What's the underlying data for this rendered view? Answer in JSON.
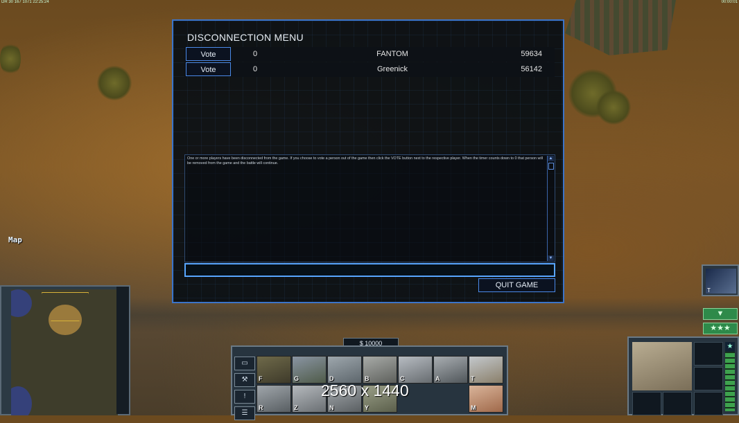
{
  "topbar": {
    "left_text": "DR 30 167 1071 22:25:24",
    "right_text": "00:00:01"
  },
  "map_label": "Map",
  "dialog": {
    "title": "DISCONNECTION MENU",
    "players": [
      {
        "vote_label": "Vote",
        "votes": "0",
        "name": "FANTOM",
        "ping": "59634"
      },
      {
        "vote_label": "Vote",
        "votes": "0",
        "name": "Greenick",
        "ping": "56142"
      }
    ],
    "message": "One or more players have been disconnected from the game. If you choose to vote a person out of the game then click the VOTE button next to the respective player. When the timer counts down to 0 that person will be removed from the game and the battle will continue.",
    "chat_value": "",
    "quit_label": "QUIT GAME"
  },
  "command_bar": {
    "money": "$ 10000",
    "side_icons": [
      "options-icon",
      "repair-icon",
      "alert-icon",
      "planning-icon"
    ],
    "buttons_row1": [
      {
        "hotkey": "F",
        "icon": "dozer-icon"
      },
      {
        "hotkey": "G",
        "icon": "infantry-icon"
      },
      {
        "hotkey": "D",
        "icon": "airfield-icon"
      },
      {
        "hotkey": "B",
        "icon": "artillery-icon"
      },
      {
        "hotkey": "C",
        "icon": "missile-icon"
      },
      {
        "hotkey": "A",
        "icon": "factory-icon"
      },
      {
        "hotkey": "T",
        "icon": "tower-icon"
      }
    ],
    "buttons_row2": [
      {
        "hotkey": "R",
        "icon": "reactor-icon"
      },
      {
        "hotkey": "Z",
        "icon": "aircraft-icon"
      },
      {
        "hotkey": "N",
        "icon": "barracks-icon"
      },
      {
        "hotkey": "Y",
        "icon": "supply-icon"
      },
      {
        "hotkey": "M",
        "icon": "ammo-icon"
      }
    ],
    "overlay_text": "2560 x 1440"
  },
  "right_panel": {
    "generals_hotkey": "T",
    "green_down": "▼",
    "green_stars": "★★★"
  }
}
